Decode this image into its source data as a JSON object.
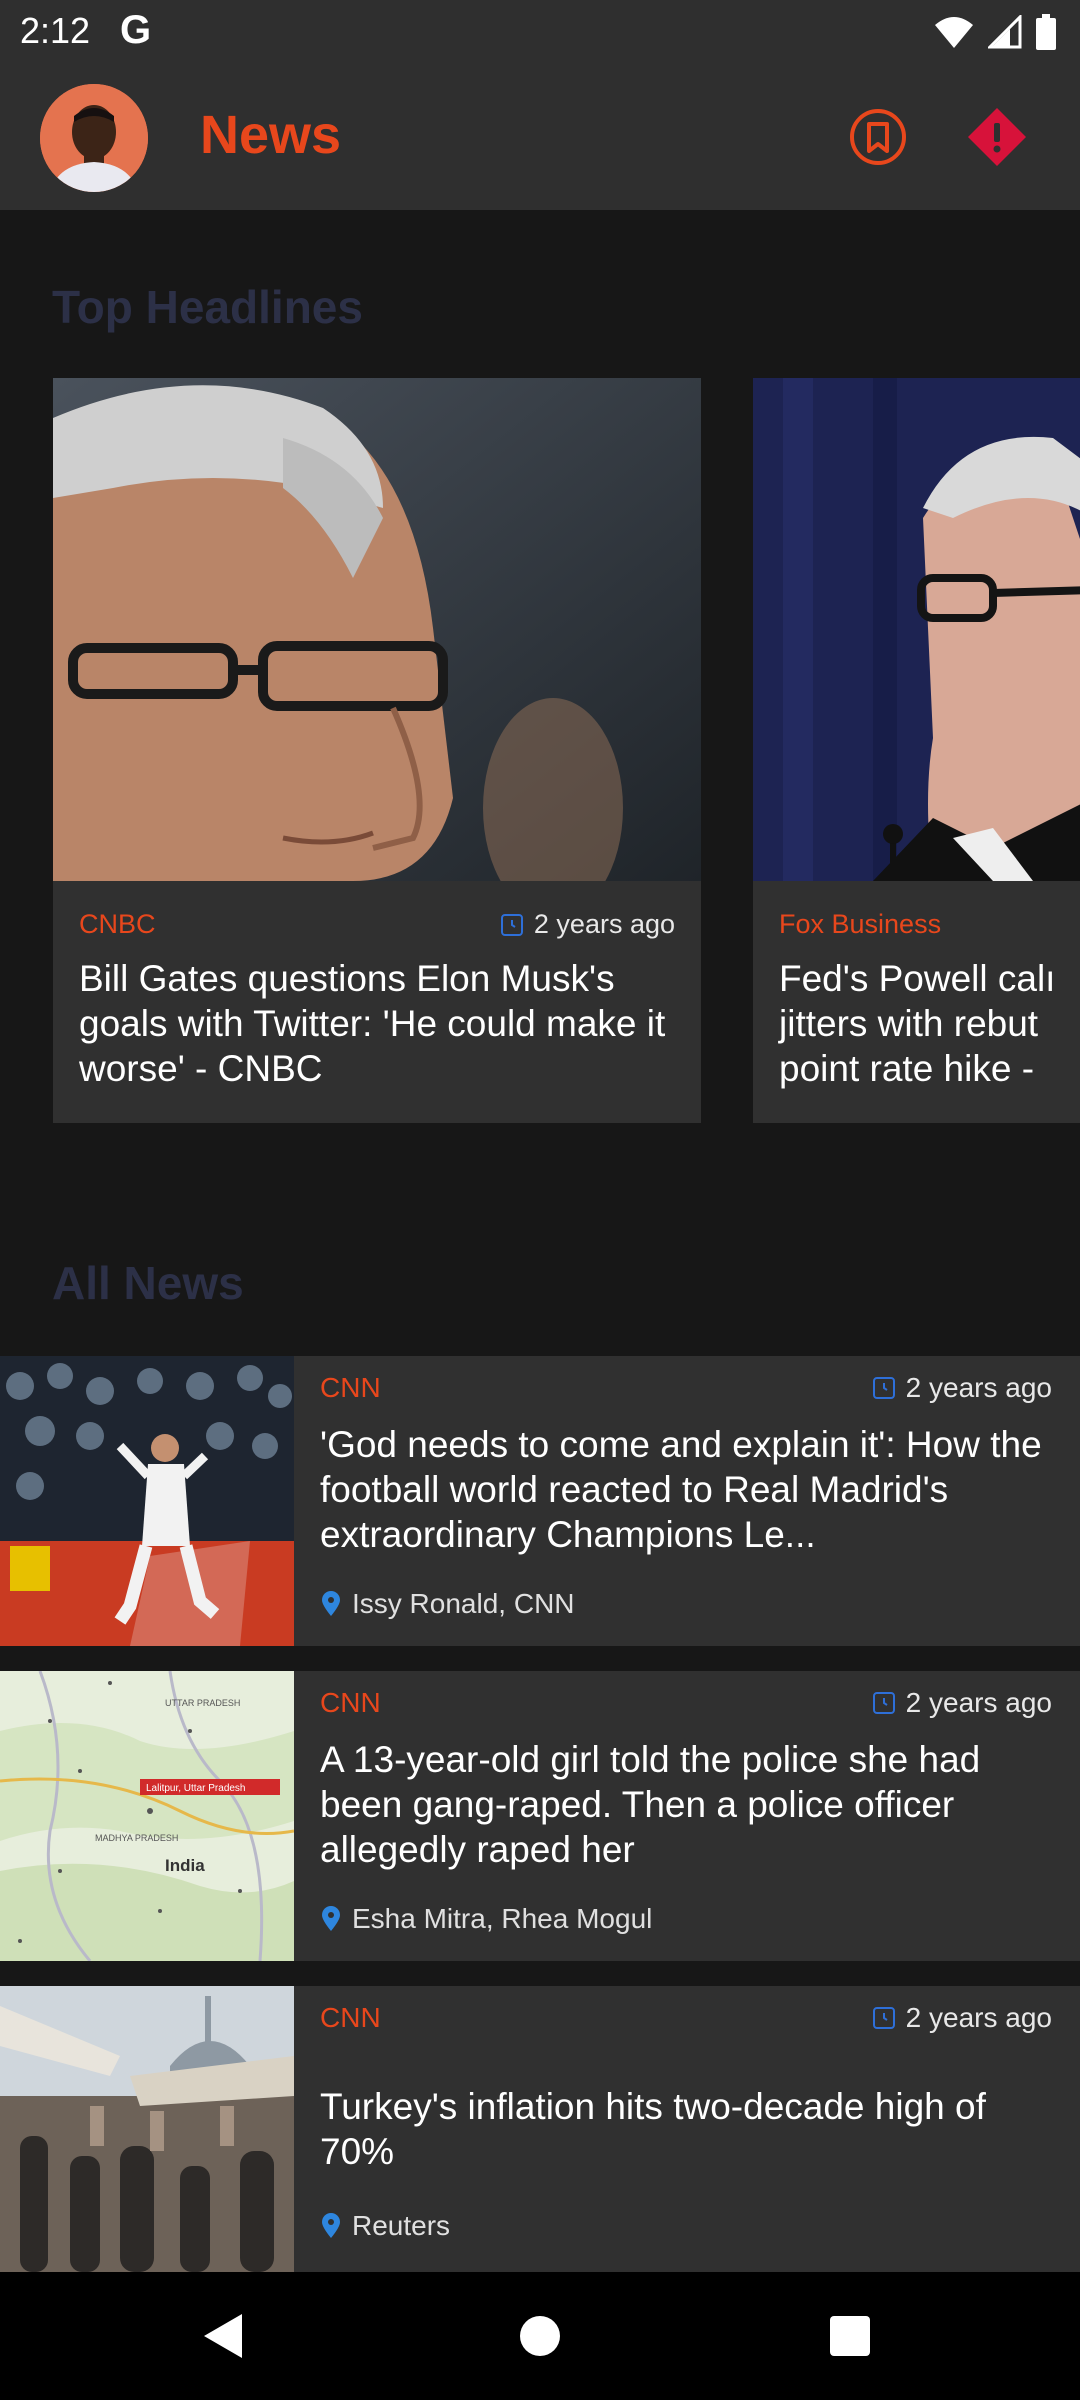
{
  "status_bar": {
    "time": "2:12",
    "carrier_glyph": "G",
    "icons": [
      "wifi-icon",
      "signal-icon",
      "battery-icon"
    ]
  },
  "app_bar": {
    "title": "News",
    "icons": [
      "avatar",
      "bookmark-icon",
      "alert-diamond-icon"
    ]
  },
  "sections": {
    "top_headlines": "Top Headlines",
    "all_news": "All News"
  },
  "headlines": [
    {
      "source": "CNBC",
      "time": "2 years ago",
      "title": "Bill Gates questions Elon Musk's goals with Twitter: 'He could make it worse' - CNBC"
    },
    {
      "source": "Fox Business",
      "time": "",
      "title_lines": [
        "Fed's Powell calı",
        "jitters with rebut",
        "point rate hike -"
      ]
    }
  ],
  "news": [
    {
      "source": "CNN",
      "time": "2 years ago",
      "title": "'God needs to come and explain it': How the football world reacted to Real Madrid's extraordinary Champions Le...",
      "author": "Issy Ronald, CNN"
    },
    {
      "source": "CNN",
      "time": "2 years ago",
      "title": "A 13-year-old girl told the police she had been gang-raped. Then a police officer allegedly raped her",
      "author": "Esha Mitra, Rhea Mogul"
    },
    {
      "source": "CNN",
      "time": "2 years ago",
      "title": "Turkey's inflation hits two-decade high of 70%",
      "author": "Reuters"
    }
  ],
  "map_labels": {
    "india": "India",
    "city_tag": "Lalitpur, Uttar Pradesh",
    "state_1": "MADHYA PRADESH",
    "state_2": "UTTAR PRADESH"
  },
  "colors": {
    "accent": "#e8471c",
    "status_background": "#2f2f2f",
    "page_background": "#171717",
    "section_heading": "#2c3047",
    "card_background": "#303030",
    "time_icon": "#2e6fd8",
    "author_pin": "#2e86de"
  }
}
